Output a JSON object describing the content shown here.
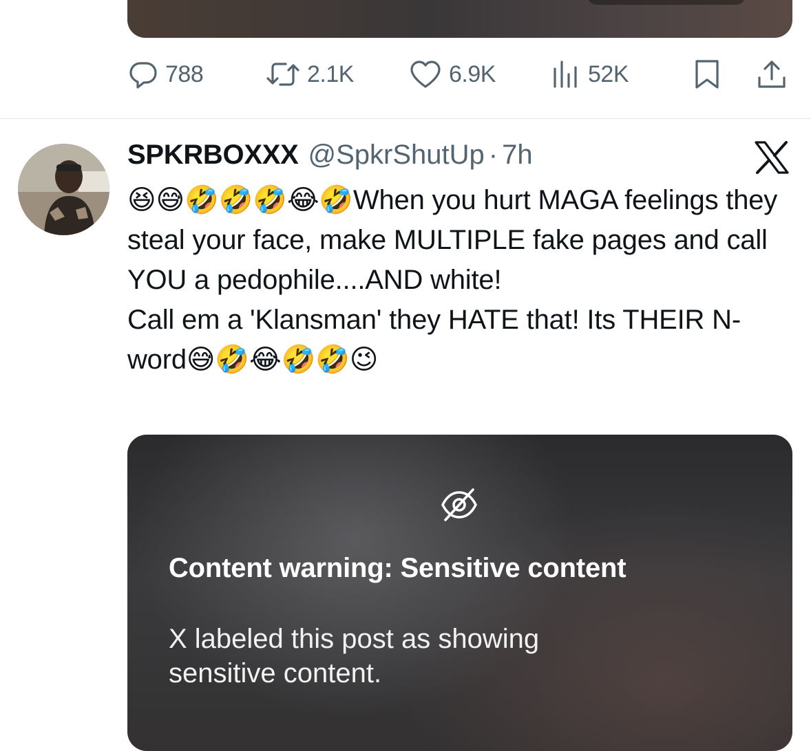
{
  "previous_post": {
    "actions": {
      "replies": "788",
      "reposts": "2.1K",
      "likes": "6.9K",
      "views": "52K"
    }
  },
  "post": {
    "display_name": "SPKRBOXXX",
    "handle": "@SpkrShutUp",
    "separator": "·",
    "time": "7h",
    "text": "😆😅🤣🤣🤣😂🤣When you hurt MAGA feelings they steal your face, make MULTIPLE fake pages and call YOU a pedophile....AND white!\nCall em a 'Klansman' they HATE that! Its THEIR N-word😅🤣😂🤣🤣😉",
    "media": {
      "warning_title": "Content warning: Sensitive content",
      "warning_description": "X labeled this post as showing sensitive content."
    }
  },
  "icons": {
    "reply": "reply-icon",
    "repost": "repost-icon",
    "like": "heart-icon",
    "views": "views-icon",
    "bookmark": "bookmark-icon",
    "share": "share-icon",
    "platform": "x-logo-icon",
    "hidden": "eye-slash-icon"
  },
  "colors": {
    "secondary_text": "#536471",
    "primary_text": "#0f1419",
    "divider": "#e1e6ea"
  }
}
